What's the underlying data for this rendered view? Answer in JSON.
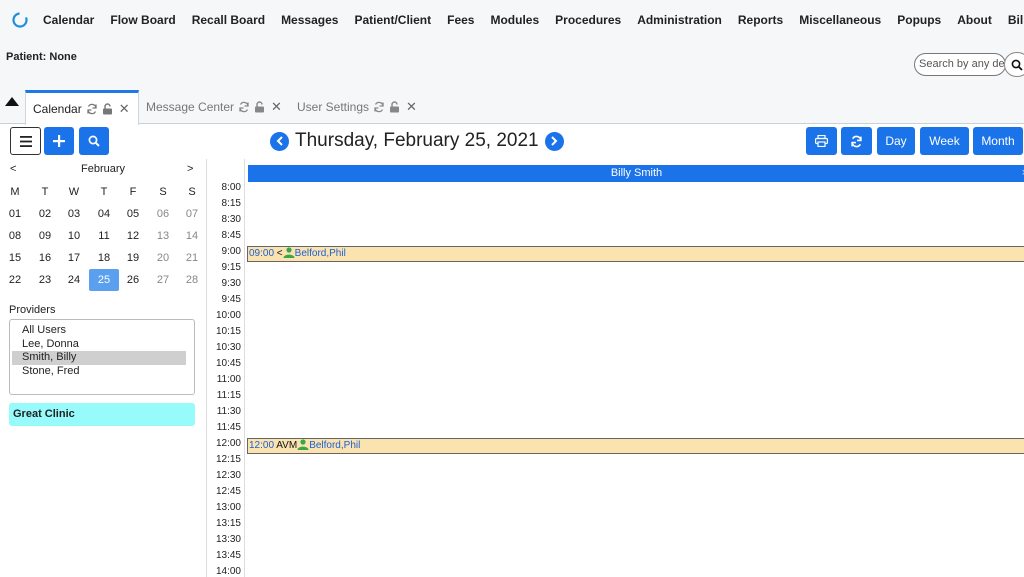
{
  "menu": [
    "Calendar",
    "Flow Board",
    "Recall Board",
    "Messages",
    "Patient/Client",
    "Fees",
    "Modules",
    "Procedures",
    "Administration",
    "Reports",
    "Miscellaneous",
    "Popups",
    "About",
    "Billy Smith"
  ],
  "patient": {
    "label": "Patient: None"
  },
  "search": {
    "placeholder": "Search by any de"
  },
  "tabs": [
    {
      "label": "Calendar"
    },
    {
      "label": "Message Center"
    },
    {
      "label": "User Settings"
    }
  ],
  "toolbar": {
    "date_title": "Thursday, February 25, 2021",
    "day_label": "Day",
    "week_label": "Week",
    "month_label": "Month"
  },
  "minical": {
    "month": "February",
    "prev": "<",
    "next": ">",
    "weekdays": [
      "M",
      "T",
      "W",
      "T",
      "F",
      "S",
      "S"
    ],
    "weeks": [
      [
        "01",
        "02",
        "03",
        "04",
        "05",
        "06",
        "07"
      ],
      [
        "08",
        "09",
        "10",
        "11",
        "12",
        "13",
        "14"
      ],
      [
        "15",
        "16",
        "17",
        "18",
        "19",
        "20",
        "21"
      ],
      [
        "22",
        "23",
        "24",
        "25",
        "26",
        "27",
        "28"
      ]
    ],
    "selected": "25"
  },
  "providers": {
    "label": "Providers",
    "items": [
      "All Users",
      "Lee, Donna",
      "Smith, Billy",
      "Stone, Fred"
    ],
    "selected": "Smith, Billy"
  },
  "facility": "Great Clinic",
  "dayview": {
    "provider": "Billy Smith",
    "close": "×",
    "times": [
      "8:00",
      "8:15",
      "8:30",
      "8:45",
      "9:00",
      "9:15",
      "9:30",
      "9:45",
      "10:00",
      "10:15",
      "10:30",
      "10:45",
      "11:00",
      "11:15",
      "11:30",
      "11:45",
      "12:00",
      "12:15",
      "12:30",
      "12:45",
      "13:00",
      "13:15",
      "13:30",
      "13:45",
      "14:00"
    ],
    "appointments": [
      {
        "time": "09:00",
        "category": " <",
        "patient": "Belford,Phil"
      },
      {
        "time": "12:00",
        "category": " AVM",
        "patient": "Belford,Phil"
      }
    ]
  },
  "colors": {
    "accent": "#1a73e8",
    "appointment_bg": "#fbe3b0",
    "facility_bg": "#97fbfb"
  }
}
